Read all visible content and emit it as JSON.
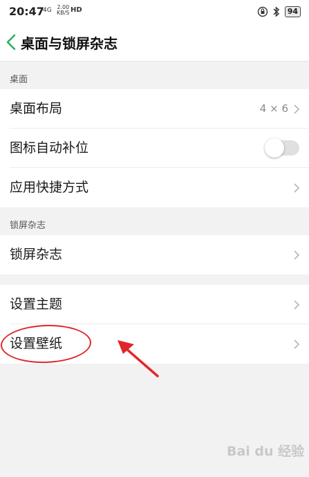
{
  "status_bar": {
    "time": "20:47",
    "signal": "4G",
    "speed_value": "2.00",
    "speed_unit": "KB/S",
    "hd": "HD",
    "battery": "94"
  },
  "header": {
    "title": "桌面与锁屏杂志"
  },
  "sections": {
    "desktop": {
      "title": "桌面",
      "layout_label": "桌面布局",
      "layout_value": "4 × 6",
      "auto_fill_label": "图标自动补位",
      "auto_fill_on": false,
      "shortcuts_label": "应用快捷方式"
    },
    "lockscreen": {
      "title": "锁屏杂志",
      "magazine_label": "锁屏杂志"
    },
    "other": {
      "theme_label": "设置主题",
      "wallpaper_label": "设置壁纸"
    }
  },
  "colors": {
    "accent": "#2fae5c",
    "annotation": "#e1262b"
  },
  "watermark": "Bai du 经验"
}
